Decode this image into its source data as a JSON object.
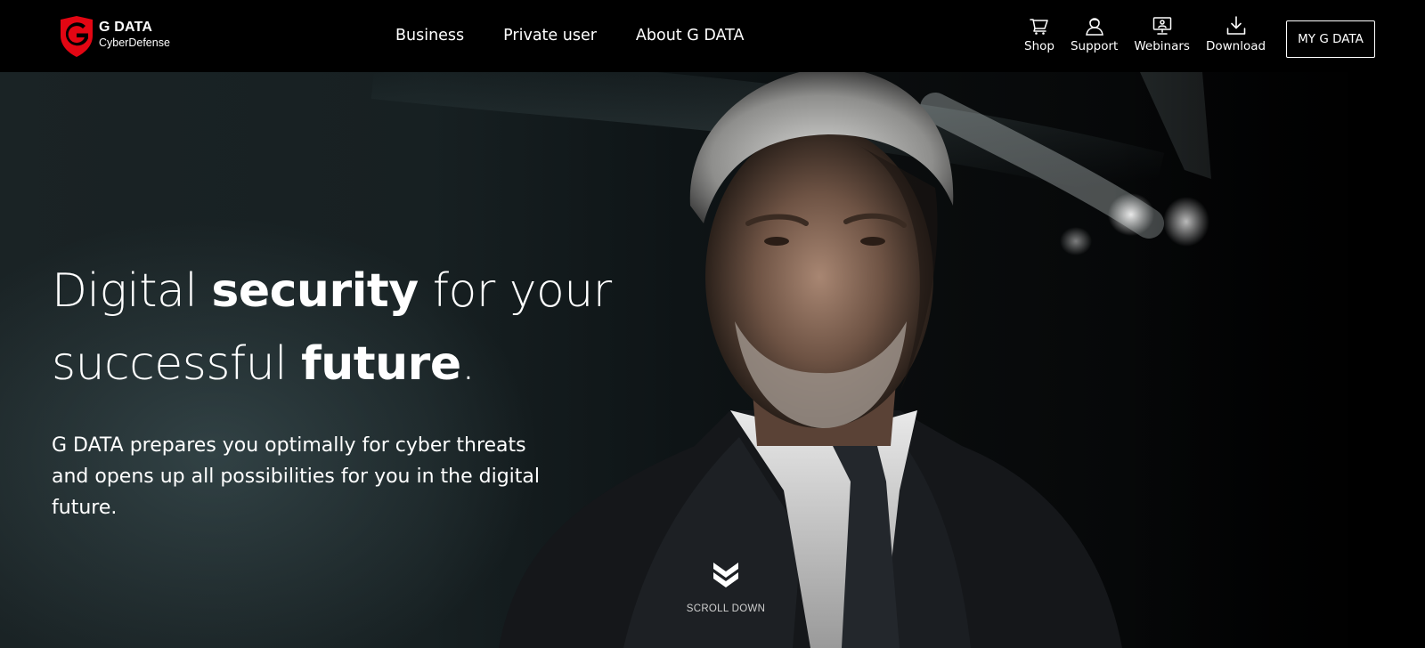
{
  "header": {
    "logo": {
      "name": "G DATA",
      "tagline": "CyberDefense",
      "brand_color": "#e30613"
    },
    "main_nav": [
      {
        "label": "Business"
      },
      {
        "label": "Private user"
      },
      {
        "label": "About G DATA"
      }
    ],
    "utility_nav": [
      {
        "label": "Shop",
        "icon": "cart-icon"
      },
      {
        "label": "Support",
        "icon": "support-user-icon"
      },
      {
        "label": "Webinars",
        "icon": "webinar-presentation-icon"
      },
      {
        "label": "Download",
        "icon": "download-icon"
      }
    ],
    "account_button": {
      "label": "MY G DATA"
    }
  },
  "hero": {
    "headline": {
      "part1": "Digital ",
      "bold1": "security",
      "part2": " for your successful ",
      "bold2": "future",
      "part3": "."
    },
    "subtext": "G DATA prepares you optimally for cyber threats and opens up all possibilities for you in the digital future.",
    "image": "businessman-portrait",
    "scroll": {
      "label": "SCROLL DOWN",
      "icon": "double-chevron-down-icon"
    }
  }
}
